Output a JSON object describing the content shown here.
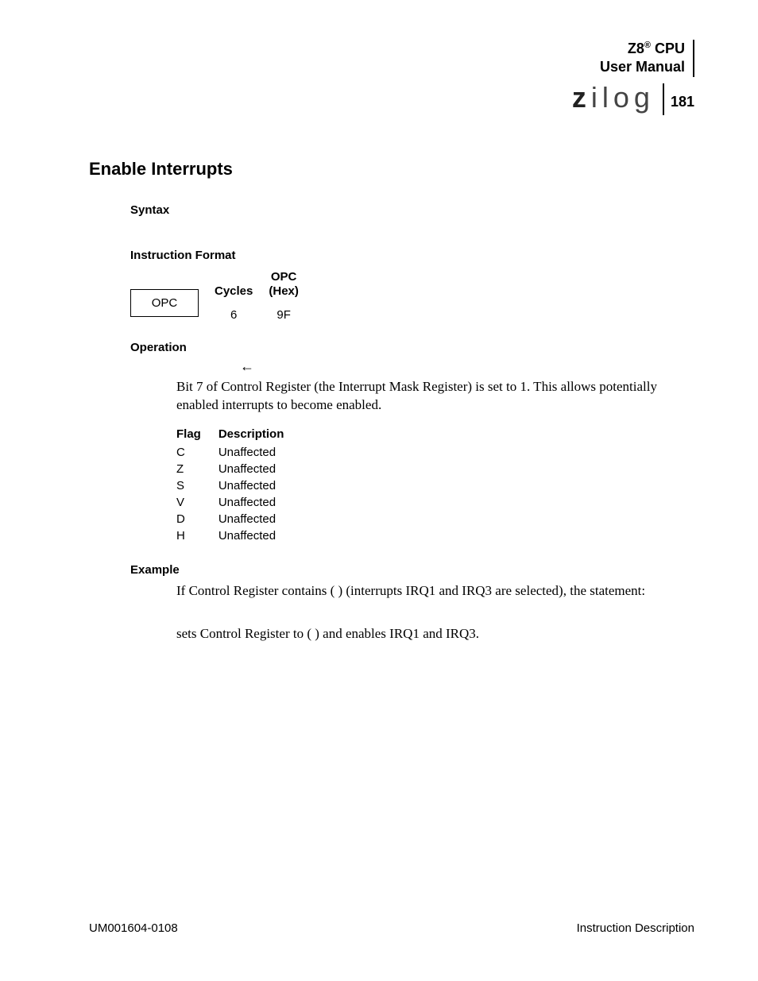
{
  "header": {
    "product_line1": "Z8",
    "product_sup": "®",
    "product_line1_suffix": " CPU",
    "product_line2": "User Manual",
    "logo_text": "zilog",
    "page_number": "181"
  },
  "title": "Enable Interrupts",
  "sections": {
    "syntax": "Syntax",
    "instruction_format": "Instruction Format",
    "operation": "Operation",
    "example": "Example"
  },
  "format_table": {
    "opc_box": "OPC",
    "cycles_header": "Cycles",
    "cycles_value": "6",
    "opc_header_l1": "OPC",
    "opc_header_l2": "(Hex)",
    "opc_value": "9F"
  },
  "operation": {
    "arrow": "←",
    "text": "Bit 7 of Control Register        (the Interrupt Mask Register) is set to 1. This allows potentially enabled interrupts to become enabled."
  },
  "flags": {
    "header_flag": "Flag",
    "header_desc": "Description",
    "rows": [
      {
        "flag": "C",
        "desc": "Unaffected"
      },
      {
        "flag": "Z",
        "desc": "Unaffected"
      },
      {
        "flag": "S",
        "desc": "Unaffected"
      },
      {
        "flag": "V",
        "desc": "Unaffected"
      },
      {
        "flag": "D",
        "desc": "Unaffected"
      },
      {
        "flag": "H",
        "desc": "Unaffected"
      }
    ]
  },
  "example": {
    "line1": "If Control Register        contains        (                ) (interrupts IRQ1 and IRQ3 are selected), the statement:",
    "line2": "sets Control Register        to        (                    ) and enables IRQ1 and IRQ3."
  },
  "footer": {
    "left": "UM001604-0108",
    "right": "Instruction Description"
  }
}
